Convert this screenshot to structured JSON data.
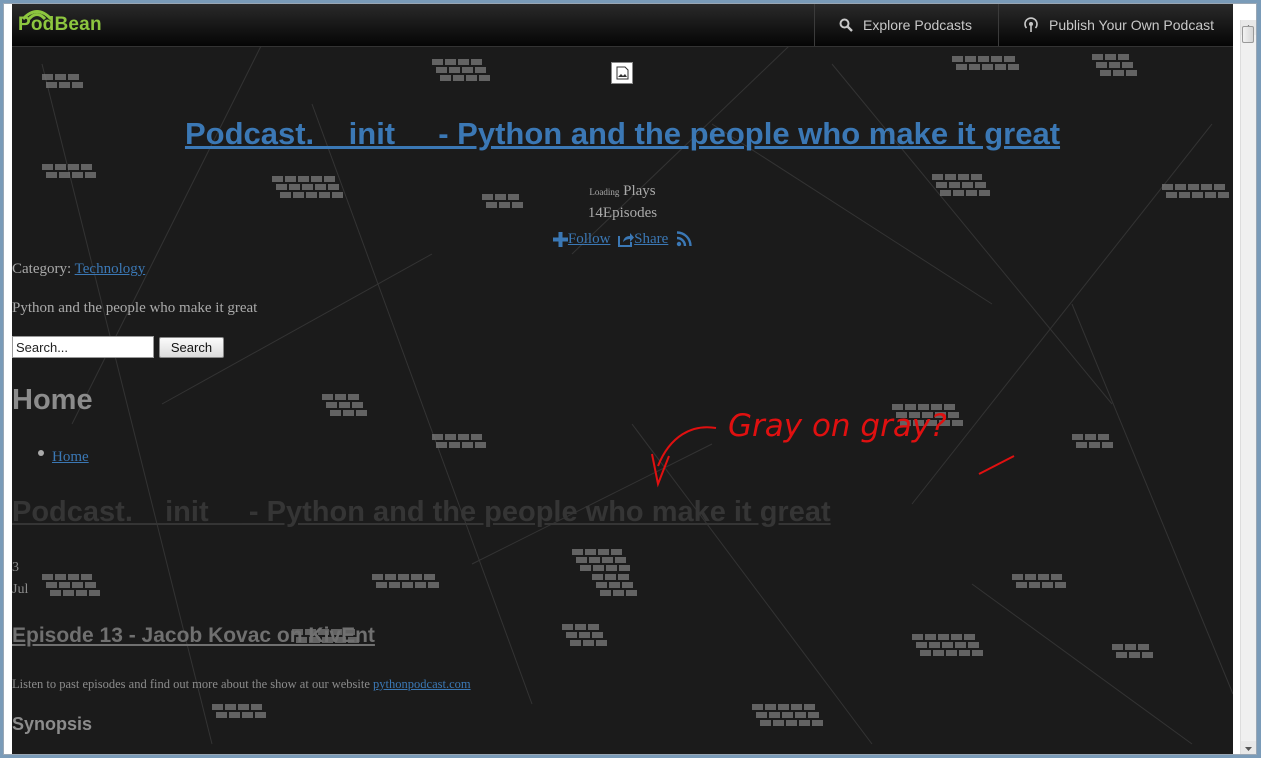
{
  "topbar": {
    "logo": "PodBean",
    "nav": [
      {
        "label": "Explore Podcasts",
        "icon": "search-icon"
      },
      {
        "label": "Publish Your Own Podcast",
        "icon": "podcast-icon"
      }
    ]
  },
  "header": {
    "title": "Podcast.__init__ - Python and the people who make it great",
    "plays_loading": "Loading",
    "plays_label": "Plays",
    "episodes_count": "14",
    "episodes_label": "Episodes",
    "follow_label": "Follow",
    "share_label": "Share"
  },
  "category": {
    "label": "Category:",
    "value": "Technology"
  },
  "description": "Python and the people who make it great",
  "search": {
    "placeholder": "Search...",
    "button_label": "Search"
  },
  "home": {
    "heading": "Home",
    "breadcrumb_link": "Home"
  },
  "post": {
    "title": "Podcast.__init__ - Python and the people who make it great",
    "date_day": "3",
    "date_month": "Jul",
    "episode_title": "Episode 13 - Jacob Kovac on KivEnt",
    "episode_text": "Listen to past episodes and find out more about the show at our website",
    "episode_link": "pythonpodcast.com",
    "synopsis_heading": "Synopsis"
  },
  "annotation": {
    "text": "Gray on gray?",
    "color": "#e01010"
  },
  "colors": {
    "link": "#3b78b5",
    "brand": "#8dc63f",
    "background": "#1b1b1b"
  }
}
